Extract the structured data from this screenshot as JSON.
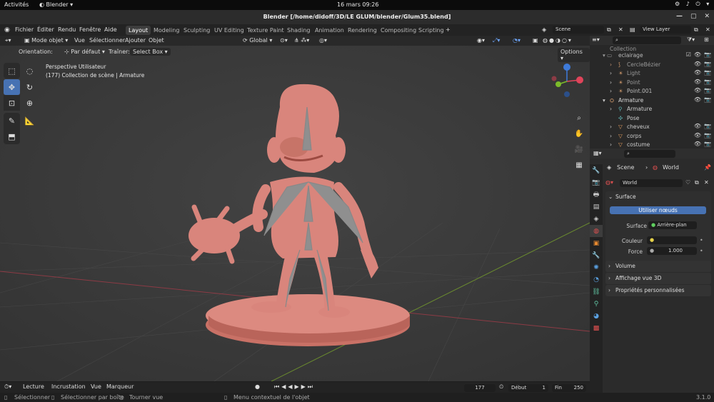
{
  "gnome": {
    "activities": "Activités",
    "app": "Blender",
    "clock": "16 mars  09:26"
  },
  "window_title": "Blender [/home/didoff/3D/LE GLUM/blender/Glum35.blend]",
  "menu": [
    "Fichier",
    "Éditer",
    "Rendu",
    "Fenêtre",
    "Aide"
  ],
  "workspaces": [
    "Layout",
    "Modeling",
    "Sculpting",
    "UV Editing",
    "Texture Paint",
    "Shading",
    "Animation",
    "Rendering",
    "Compositing",
    "Scripting"
  ],
  "scene": "Scene",
  "view_layer": "View Layer",
  "viewport": {
    "mode": "Mode objet",
    "menus": [
      "Vue",
      "Sélectionner",
      "Ajouter",
      "Objet"
    ],
    "transform": "Global",
    "orientation_label": "Orientation:",
    "orientation_value": "Par défaut",
    "drag_label": "Traîner:",
    "drag_value": "Select Box",
    "options": "Options",
    "info1": "Perspective Utilisateur",
    "info2": "(177) Collection de scène | Armature"
  },
  "outliner": {
    "rows": [
      {
        "label": "Collection"
      },
      {
        "label": "eclairage"
      },
      {
        "label": "CercleBézier"
      },
      {
        "label": "Light"
      },
      {
        "label": "Point"
      },
      {
        "label": "Point.001"
      },
      {
        "label": "Armature"
      },
      {
        "label": "Armature"
      },
      {
        "label": "Pose"
      },
      {
        "label": "cheveux"
      },
      {
        "label": "corps"
      },
      {
        "label": "costume"
      }
    ]
  },
  "properties": {
    "breadcrumb1": "Scene",
    "breadcrumb2": "World",
    "world_name": "World",
    "surface_panel": "Surface",
    "use_nodes": "Utiliser nœuds",
    "surface_label": "Surface",
    "surface_value": "Arrière-plan",
    "color_label": "Couleur",
    "strength_label": "Force",
    "strength_value": "1.000",
    "panels": [
      "Volume",
      "Affichage vue 3D",
      "Propriétés personnalisées"
    ]
  },
  "timeline": {
    "menus": [
      "Lecture",
      "Incrustation",
      "Vue",
      "Marqueur"
    ],
    "frame": "177",
    "start_label": "Début",
    "start": "1",
    "end_label": "Fin",
    "end": "250"
  },
  "status": {
    "s1": "Sélectionner",
    "s2": "Sélectionner par boîte",
    "s3": "Tourner vue",
    "s4": "Menu contextuel de l'objet",
    "version": "3.1.0"
  },
  "colors": {
    "accent": "#4772b3",
    "character": "#d9857c",
    "viewport_bg": "#3a3a3a",
    "x_axis": "#e0445a",
    "y_axis": "#7cbb2a",
    "z_axis": "#3e7ad9"
  }
}
